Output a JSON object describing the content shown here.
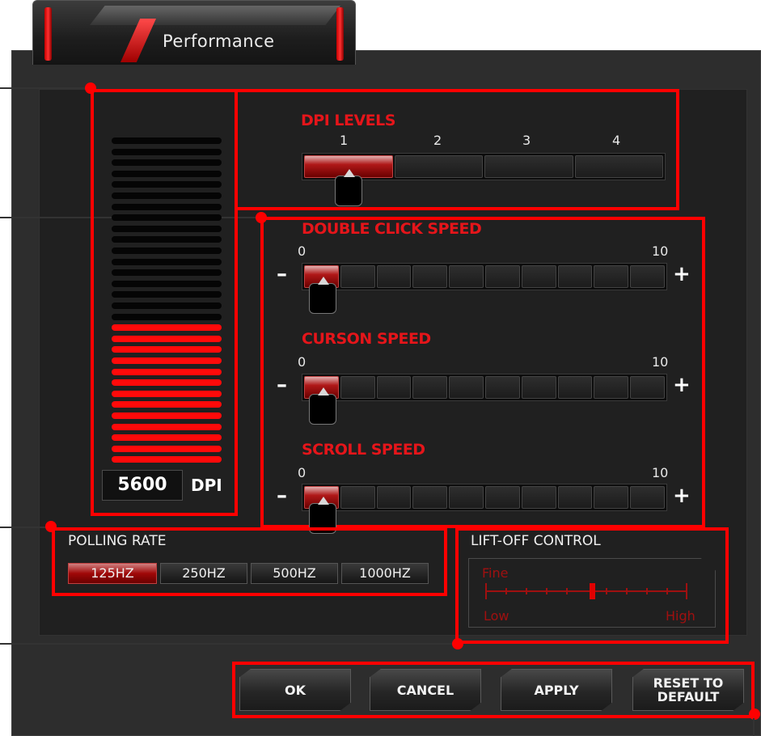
{
  "tab": {
    "title": "Performance"
  },
  "dpi": {
    "value": "5600",
    "unit": "DPI",
    "meter_level": 0.4
  },
  "dpi_levels": {
    "label": "DPI LEVELS",
    "levels": [
      "1",
      "2",
      "3",
      "4"
    ],
    "selected": 1
  },
  "sliders": [
    {
      "label": "DOUBLE CLICK SPEED",
      "min": "0",
      "max": "10",
      "value": 1,
      "minus": "–",
      "plus": "+"
    },
    {
      "label": "CURSON SPEED",
      "min": "0",
      "max": "10",
      "value": 1,
      "minus": "–",
      "plus": "+"
    },
    {
      "label": "SCROLL SPEED",
      "min": "0",
      "max": "10",
      "value": 1,
      "minus": "–",
      "plus": "+"
    }
  ],
  "polling": {
    "label": "POLLING RATE",
    "options": [
      "125HZ",
      "250HZ",
      "500HZ",
      "1000HZ"
    ],
    "selected": "125HZ"
  },
  "lift_off": {
    "label": "LIFT-OFF CONTROL",
    "fine": "Fine",
    "low": "Low",
    "high": "High",
    "value": 0.5
  },
  "buttons": {
    "ok": "OK",
    "cancel": "CANCEL",
    "apply": "APPLY",
    "reset_line1": "RESET TO",
    "reset_line2": "DEFAULT"
  },
  "colors": {
    "accent": "#ff0000",
    "panel": "#2d2d2d",
    "inner": "#202020"
  },
  "icons": {
    "decrease": "minus-icon",
    "increase": "plus-icon",
    "knob": "slider-knob-icon"
  }
}
